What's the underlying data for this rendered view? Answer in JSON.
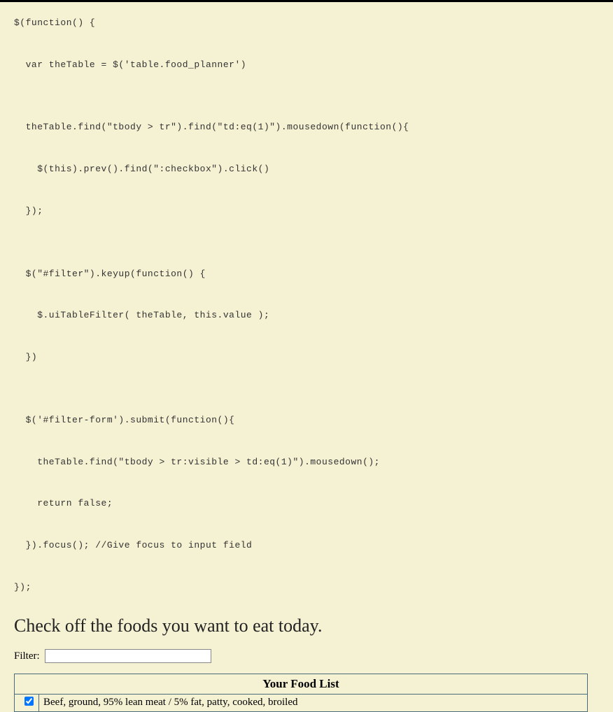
{
  "code": {
    "lines": [
      "$(function() {",
      "",
      "  var theTable = $('table.food_planner')",
      "",
      "",
      "  theTable.find(\"tbody > tr\").find(\"td:eq(1)\").mousedown(function(){",
      "",
      "    $(this).prev().find(\":checkbox\").click()",
      "",
      "  });",
      "",
      "",
      "  $(\"#filter\").keyup(function() {",
      "",
      "    $.uiTableFilter( theTable, this.value );",
      "",
      "  })",
      "",
      "",
      "  $('#filter-form').submit(function(){",
      "",
      "    theTable.find(\"tbody > tr:visible > td:eq(1)\").mousedown();",
      "",
      "    return false;",
      "",
      "  }).focus(); //Give focus to input field",
      "",
      "});"
    ]
  },
  "heading": "Check off the foods you want to eat today.",
  "filter": {
    "label": "Filter:",
    "value": ""
  },
  "table": {
    "header": "Your Food List",
    "rows": [
      {
        "checked": true,
        "name": "Beef, ground, 95% lean meat / 5% fat, patty, cooked, broiled"
      }
    ]
  }
}
